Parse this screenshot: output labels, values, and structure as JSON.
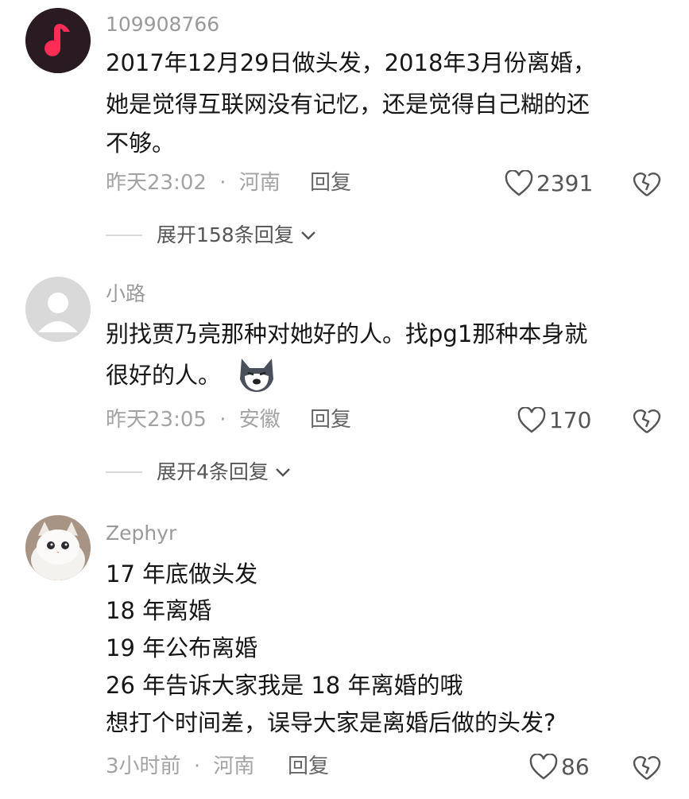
{
  "comments": [
    {
      "username": "109908766",
      "lines": [
        "2017年12月29日做头发，2018年3月份离婚，",
        "她是觉得互联网没有记忆，还是觉得自己糊的还",
        "不够。"
      ],
      "time": "昨天23:02",
      "region": "河南",
      "reply_label": "回复",
      "likes": "2391",
      "expand_label": "展开158条回复",
      "avatar_icon": "music-note-icon"
    },
    {
      "username": "小路",
      "lines": [
        "别找贾乃亮那种对她好的人。找pg1那种本身就",
        "很好的人。"
      ],
      "time": "昨天23:05",
      "region": "安徽",
      "reply_label": "回复",
      "likes": "170",
      "expand_label": "展开4条回复",
      "avatar_icon": "default-user-icon",
      "emoji_icon": "husky-dog-emoji"
    },
    {
      "username": "Zephyr",
      "lines": [
        "17 年底做头发",
        "18 年离婚",
        "19 年公布离婚",
        "26 年告诉大家我是 18 年离婚的哦",
        "想打个时间差，误导大家是离婚后做的头发?"
      ],
      "time": "3小时前",
      "region": "河南",
      "reply_label": "回复",
      "likes": "86",
      "avatar_icon": "white-cat-photo"
    }
  ],
  "separator": "·",
  "colors": {
    "music_avatar_bg": "#2a1a22",
    "music_note": "#ff2d55",
    "default_avatar": "#d9d9d9"
  }
}
